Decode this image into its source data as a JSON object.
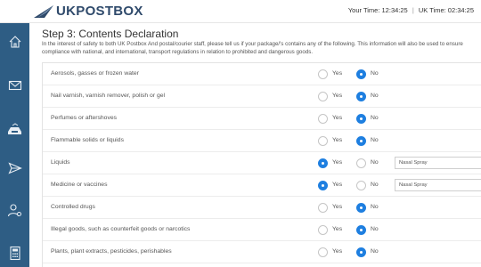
{
  "header": {
    "logo_text": "UKPOSTBOX",
    "your_time_label": "Your Time:",
    "your_time": "12:34:25",
    "uk_time_label": "UK Time:",
    "uk_time": "02:34:25"
  },
  "sidebar": {
    "items": [
      {
        "icon": "home-icon"
      },
      {
        "icon": "mail-icon"
      },
      {
        "icon": "inbox-tray-icon"
      },
      {
        "icon": "send-icon"
      },
      {
        "icon": "user-settings-icon"
      },
      {
        "icon": "calculator-icon"
      }
    ]
  },
  "page": {
    "title": "Step 3: Contents Declaration",
    "intro": "In the interest of safety to both UK Postbox And postal/courier staff, please tell us if your package/'s contains any of the following. This information will also be used to ensure compliance with national, and international, transport regulations in relation to prohibited and dangerous goods.",
    "yes_label": "Yes",
    "no_label": "No"
  },
  "declarations": [
    {
      "label": "Aerosols, gasses or frozen water",
      "answer": "No",
      "detail": null
    },
    {
      "label": "Nail varnish, varnish remover, polish or gel",
      "answer": "No",
      "detail": null
    },
    {
      "label": "Perfumes or aftershoves",
      "answer": "No",
      "detail": null
    },
    {
      "label": "Flammable solids or liquids",
      "answer": "No",
      "detail": null
    },
    {
      "label": "Liquids",
      "answer": "Yes",
      "detail": "Nasal Spray"
    },
    {
      "label": "Medicine or vaccines",
      "answer": "Yes",
      "detail": "Nasal Spray"
    },
    {
      "label": "Controlled drugs",
      "answer": "No",
      "detail": null
    },
    {
      "label": "Illegal goods, such as counterfeit goods or narcotics",
      "answer": "No",
      "detail": null
    },
    {
      "label": "Plants, plant extracts, pesticides, perishables",
      "answer": "No",
      "detail": null
    }
  ],
  "colors": {
    "sidebar": "#2e5d84",
    "radio_selected": "#1e7fe0",
    "logo": "#2f4a6b"
  }
}
